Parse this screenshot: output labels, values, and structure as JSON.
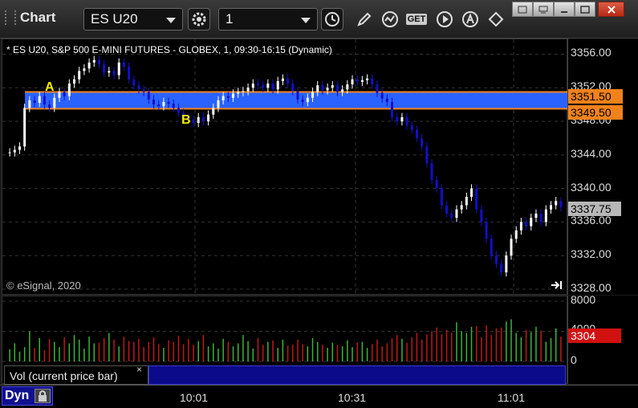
{
  "toolbar": {
    "app_title": "Chart",
    "symbol_value": "ES U20",
    "interval_value": "1",
    "get_label": "GET"
  },
  "chart": {
    "symbol_info": "* ES U20, S&P 500 E-MINI FUTURES - GLOBEX, 1, 09:30-16:15 (Dynamic)",
    "copyright": "© eSignal, 2020",
    "marker_a": "A",
    "marker_b": "B",
    "price_upper_label": "3351.50",
    "price_lower_label": "3349.50",
    "last_price_label": "3337.75",
    "y_ticks": [
      "3356.00",
      "3352.00",
      "3348.00",
      "3344.00",
      "3340.00",
      "3336.00",
      "3332.00",
      "3328.00"
    ],
    "colors": {
      "band": "#2a62ff",
      "band_line": "#f0821c",
      "up": "#ffffff",
      "down": "#1010c8",
      "marker": "#f5ec00"
    }
  },
  "volume": {
    "label": "Vol (current price bar)",
    "close_symbol": "×",
    "y_ticks": [
      "8000",
      "4000",
      "0"
    ],
    "current_label": "3304"
  },
  "timeaxis": {
    "dyn_label": "Dyn",
    "x_ticks": [
      "10:01",
      "10:31",
      "11:01"
    ]
  },
  "chart_data": {
    "type": "candlestick",
    "ylim": [
      3328,
      3357
    ],
    "band": [
      3349.5,
      3351.5
    ],
    "last_price": 3337.75,
    "bars_note": "1-minute OHLC",
    "prices": [
      3344.3,
      3344.6,
      3345.0,
      3349.6,
      3350.5,
      3350.2,
      3351.0,
      3350.0,
      3349.6,
      3350.8,
      3351.5,
      3351.0,
      3352.5,
      3353.0,
      3354.0,
      3354.3,
      3355.0,
      3355.3,
      3354.8,
      3353.8,
      3354.0,
      3353.5,
      3355.0,
      3354.5,
      3353.0,
      3352.3,
      3351.8,
      3351.5,
      3350.6,
      3350.0,
      3349.8,
      3350.3,
      3350.1,
      3349.6,
      3349.0,
      3348.5,
      3348.2,
      3347.8,
      3348.5,
      3348.0,
      3348.8,
      3349.6,
      3350.5,
      3351.0,
      3350.8,
      3351.3,
      3351.5,
      3351.6,
      3352.0,
      3352.5,
      3352.3,
      3352.0,
      3352.5,
      3351.8,
      3352.8,
      3353.1,
      3352.5,
      3351.6,
      3350.6,
      3350.3,
      3350.8,
      3351.5,
      3352.3,
      3351.7,
      3352.0,
      3352.3,
      3351.5,
      3351.8,
      3352.4,
      3353.0,
      3352.7,
      3352.9,
      3353.1,
      3352.4,
      3351.4,
      3350.7,
      3350.3,
      3348.5,
      3348.0,
      3348.5,
      3347.5,
      3347.0,
      3346.0,
      3345.0,
      3343.0,
      3341.0,
      3340.0,
      3338.0,
      3337.0,
      3336.5,
      3337.5,
      3338.0,
      3339.0,
      3340.0,
      3337.5,
      3336.0,
      3334.0,
      3332.0,
      3331.0,
      3330.0,
      3332.0,
      3334.0,
      3335.0,
      3336.0,
      3335.5,
      3336.5,
      3337.0,
      3336.0,
      3337.5,
      3338.0,
      3338.5,
      3337.75
    ],
    "volume_ylim": [
      0,
      8000
    ],
    "volume": [
      1600,
      2400,
      1300,
      1900,
      4000,
      1800,
      3100,
      1500,
      3000,
      2600,
      1900,
      3200,
      2400,
      3500,
      2900,
      1700,
      3300,
      2400,
      2500,
      3100,
      3800,
      2900,
      2000,
      3300,
      2700,
      2600,
      3000,
      1900,
      2600,
      3200,
      2300,
      1800,
      2800,
      2600,
      3400,
      2300,
      3000,
      2200,
      2700,
      3500,
      2000,
      2400,
      1700,
      3000,
      2600,
      2000,
      2400,
      3500,
      2700,
      1700,
      3100,
      2200,
      2600,
      2800,
      1800,
      2900,
      2100,
      2200,
      2900,
      2300,
      2000,
      3100,
      2600,
      2200,
      1800,
      2500,
      2200,
      2000,
      2800,
      1900,
      2500,
      2600,
      1800,
      2300,
      2900,
      2000,
      2400,
      3100,
      3500,
      3000,
      2500,
      3200,
      3800,
      2900,
      3600,
      4000,
      4500,
      3600,
      4200,
      3800,
      5200,
      4000,
      3800,
      4600,
      4700,
      3200,
      4800,
      3500,
      4400,
      4500,
      5300,
      5600,
      3800,
      3200,
      4200,
      3900,
      4600,
      4100,
      2600,
      3100,
      4400,
      3304
    ]
  }
}
